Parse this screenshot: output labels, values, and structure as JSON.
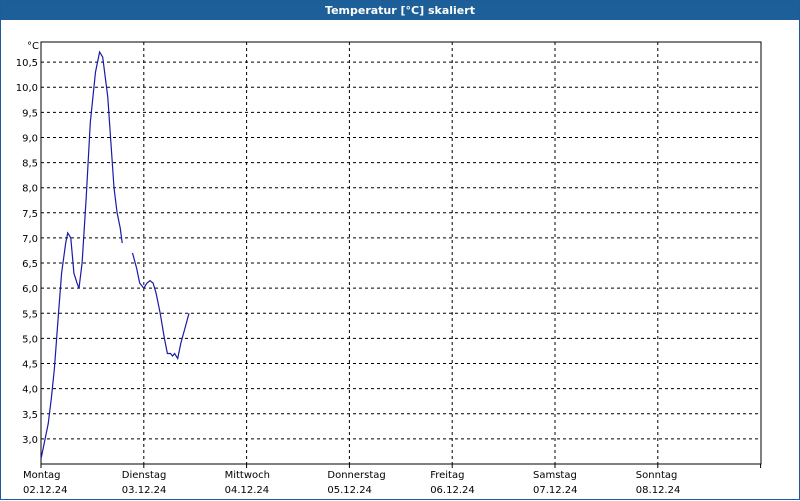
{
  "window": {
    "title": "Temperatur [°C] skaliert"
  },
  "chart_data": {
    "type": "line",
    "title": "Temperatur [°C] skaliert",
    "ylabel": "°C",
    "xlabel": "",
    "ylim": [
      2.5,
      10.9
    ],
    "y_ticks": [
      3.0,
      3.5,
      4.0,
      4.5,
      5.0,
      5.5,
      6.0,
      6.5,
      7.0,
      7.5,
      8.0,
      8.5,
      9.0,
      9.5,
      10.0,
      10.5
    ],
    "y_tick_labels": [
      "3,0",
      "3,5",
      "4,0",
      "4,5",
      "5,0",
      "5,5",
      "6,0",
      "6,5",
      "7,0",
      "7,5",
      "8,0",
      "8,5",
      "9,0",
      "9,5",
      "10,0",
      "10,5"
    ],
    "x_range_days": [
      0,
      7
    ],
    "x_ticks": [
      {
        "day": "Montag",
        "date": "02.12.24"
      },
      {
        "day": "Dienstag",
        "date": "03.12.24"
      },
      {
        "day": "Mittwoch",
        "date": "04.12.24"
      },
      {
        "day": "Donnerstag",
        "date": "05.12.24"
      },
      {
        "day": "Freitag",
        "date": "06.12.24"
      },
      {
        "day": "Samstag",
        "date": "07.12.24"
      },
      {
        "day": "Sonntag",
        "date": "08.12.24"
      }
    ],
    "grid": true,
    "line_color": "#1a1aa6",
    "series": [
      {
        "segments": [
          [
            [
              0.0,
              2.6
            ],
            [
              0.04,
              3.0
            ],
            [
              0.07,
              3.3
            ],
            [
              0.1,
              3.8
            ],
            [
              0.13,
              4.4
            ],
            [
              0.17,
              5.5
            ],
            [
              0.2,
              6.3
            ],
            [
              0.24,
              6.9
            ],
            [
              0.26,
              7.1
            ],
            [
              0.29,
              7.0
            ],
            [
              0.32,
              6.3
            ],
            [
              0.35,
              6.1
            ],
            [
              0.37,
              6.0
            ],
            [
              0.4,
              6.5
            ],
            [
              0.44,
              7.8
            ],
            [
              0.48,
              9.3
            ],
            [
              0.53,
              10.3
            ],
            [
              0.57,
              10.7
            ],
            [
              0.6,
              10.6
            ],
            [
              0.65,
              9.8
            ],
            [
              0.68,
              8.9
            ],
            [
              0.71,
              8.0
            ],
            [
              0.74,
              7.5
            ],
            [
              0.77,
              7.2
            ],
            [
              0.79,
              6.9
            ]
          ],
          [
            [
              0.89,
              6.7
            ],
            [
              0.93,
              6.4
            ],
            [
              0.96,
              6.1
            ],
            [
              1.0,
              6.0
            ],
            [
              1.03,
              6.1
            ],
            [
              1.06,
              6.15
            ],
            [
              1.09,
              6.1
            ],
            [
              1.12,
              5.9
            ],
            [
              1.16,
              5.5
            ],
            [
              1.2,
              5.0
            ],
            [
              1.23,
              4.7
            ],
            [
              1.26,
              4.7
            ],
            [
              1.28,
              4.65
            ],
            [
              1.3,
              4.7
            ],
            [
              1.33,
              4.6
            ],
            [
              1.36,
              4.9
            ],
            [
              1.4,
              5.2
            ],
            [
              1.44,
              5.5
            ]
          ]
        ]
      }
    ]
  }
}
